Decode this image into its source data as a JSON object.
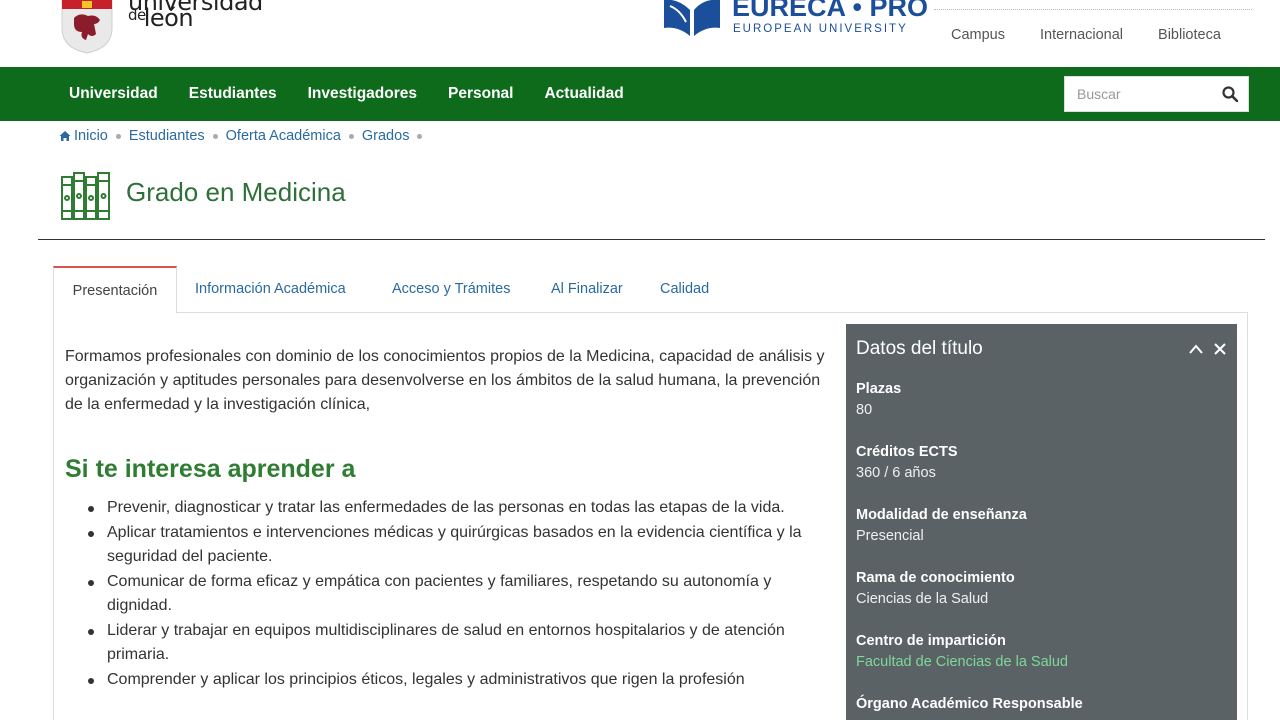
{
  "header": {
    "logo_line1": "universidad",
    "logo_de": "de",
    "logo_line2": "león",
    "eureca_title": "EURECA • PRO",
    "eureca_subtitle": "EUROPEAN UNIVERSITY",
    "top_links": [
      "Campus",
      "Internacional",
      "Biblioteca"
    ]
  },
  "nav": {
    "items": [
      "Universidad",
      "Estudiantes",
      "Investigadores",
      "Personal",
      "Actualidad"
    ],
    "search_placeholder": "Buscar"
  },
  "breadcrumb": [
    "Inicio",
    "Estudiantes",
    "Oferta Académica",
    "Grados"
  ],
  "page": {
    "title": "Grado en Medicina"
  },
  "tabs": [
    {
      "label": "Presentación",
      "active": true
    },
    {
      "label": "Información Académica",
      "active": false
    },
    {
      "label": "Acceso y Trámites",
      "active": false
    },
    {
      "label": "Al Finalizar",
      "active": false
    },
    {
      "label": "Calidad",
      "active": false
    }
  ],
  "content": {
    "intro": "Formamos profesionales con dominio de los conocimientos propios de la Medicina, capacidad de análisis y organización y aptitudes personales para desenvolverse en los ámbitos de la salud humana, la prevención de la enfermedad y la investigación clínica,",
    "heading": "Si te interesa aprender a",
    "bullets": [
      "Prevenir, diagnosticar y tratar las enfermedades de las personas en todas las etapas de la vida.",
      "Aplicar tratamientos e intervenciones médicas y quirúrgicas basados en la evidencia científica y la seguridad del paciente.",
      "Comunicar de forma eficaz y empática con pacientes y familiares, respetando su autonomía y dignidad.",
      "Liderar y trabajar en equipos multidisciplinares de salud en entornos hospitalarios y de atención primaria.",
      "Comprender y aplicar los principios éticos, legales y administrativos que rigen la profesión"
    ]
  },
  "panel": {
    "title": "Datos del título",
    "fields": [
      {
        "label": "Plazas",
        "value": "80"
      },
      {
        "label": "Créditos ECTS",
        "value": "360 / 6 años"
      },
      {
        "label": "Modalidad de enseñanza",
        "value": "Presencial"
      },
      {
        "label": "Rama de conocimiento",
        "value": "Ciencias de la Salud"
      },
      {
        "label": "Centro de impartición",
        "value": "Facultad de Ciencias de la Salud"
      },
      {
        "label": "Órgano Académico Responsable",
        "value": ""
      }
    ]
  },
  "colors": {
    "nav_green": "#0e6b1c",
    "heading_green": "#2e7d32",
    "link_blue": "#2a6aa0",
    "panel_gray": "#5a6266",
    "active_tab_accent": "#d9534f",
    "eureca_blue": "#1b4f9c"
  }
}
